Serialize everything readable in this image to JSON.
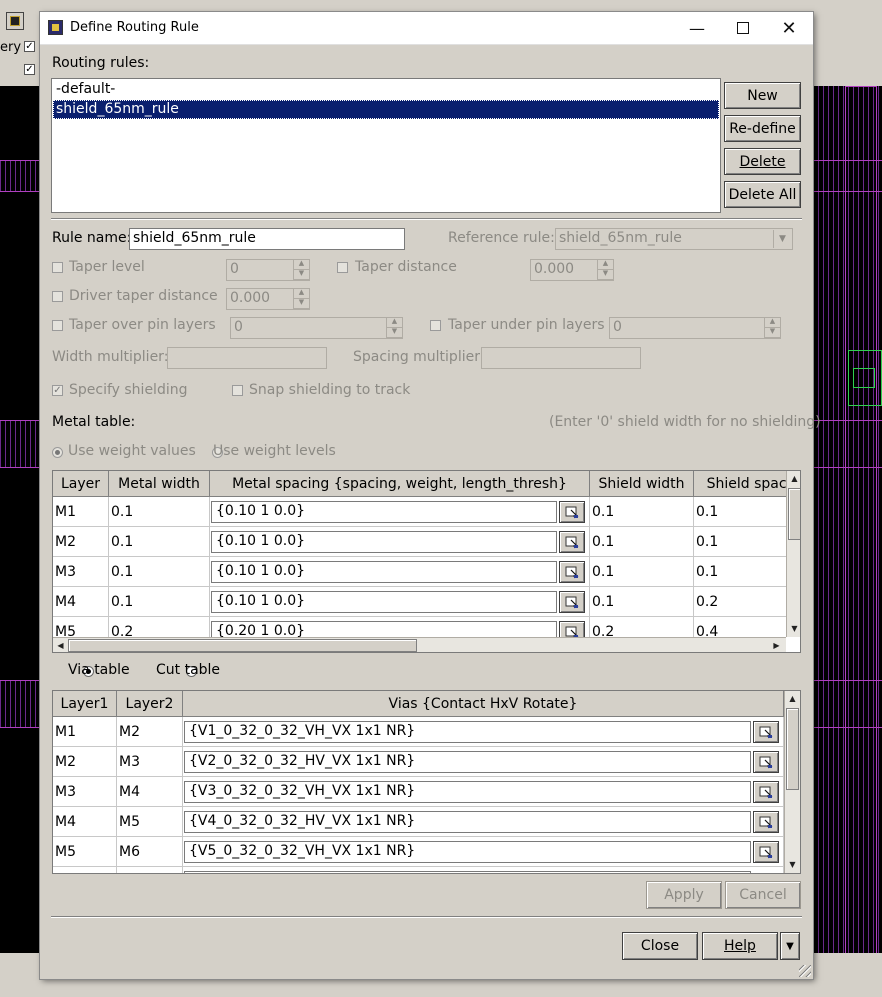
{
  "background": {
    "toolbar_fragment": "ery"
  },
  "dialog": {
    "title": "Define Routing Rule",
    "routing_rules_label": "Routing rules:",
    "routing_rules": [
      "-default-",
      "shield_65nm_rule"
    ],
    "selected_rule_index": 1,
    "side_buttons": {
      "new": "New",
      "redefine": "Re-define",
      "delete": "Delete",
      "delete_all": "Delete All"
    },
    "rule_name_label": "Rule name:",
    "rule_name_value": "shield_65nm_rule",
    "reference_rule_label": "Reference rule:",
    "reference_rule_value": "shield_65nm_rule",
    "taper_level_label": "Taper level",
    "taper_level_value": "0",
    "taper_distance_label": "Taper distance",
    "taper_distance_value": "0.000",
    "driver_taper_distance_label": "Driver taper distance",
    "driver_taper_distance_value": "0.000",
    "taper_over_pin_layers_label": "Taper over pin layers",
    "taper_over_pin_layers_value": "0",
    "taper_under_pin_layers_label": "Taper under pin layers",
    "taper_under_pin_layers_value": "0",
    "width_multiplier_label": "Width multiplier:",
    "spacing_multiplier_label": "Spacing multiplier:",
    "specify_shielding_label": "Specify shielding",
    "snap_shielding_label": "Snap shielding to track",
    "metal_table_label": "Metal table:",
    "shield_hint": "(Enter '0' shield width for no shielding)",
    "use_weight_values_label": "Use weight values",
    "use_weight_levels_label": "Use weight levels",
    "metal_table": {
      "headers": [
        "Layer",
        "Metal width",
        "Metal spacing {spacing, weight, length_thresh}",
        "Shield width",
        "Shield spaci"
      ],
      "rows": [
        {
          "layer": "M1",
          "width": "0.1",
          "spacing": "{0.10 1 0.0}",
          "shield_width": "0.1",
          "shield_spacing": "0.1"
        },
        {
          "layer": "M2",
          "width": "0.1",
          "spacing": "{0.10 1 0.0}",
          "shield_width": "0.1",
          "shield_spacing": "0.1"
        },
        {
          "layer": "M3",
          "width": "0.1",
          "spacing": "{0.10 1 0.0}",
          "shield_width": "0.1",
          "shield_spacing": "0.1"
        },
        {
          "layer": "M4",
          "width": "0.1",
          "spacing": "{0.10 1 0.0}",
          "shield_width": "0.1",
          "shield_spacing": "0.2"
        },
        {
          "layer": "M5",
          "width": "0.2",
          "spacing": "{0.20 1 0.0}",
          "shield_width": "0.2",
          "shield_spacing": "0.4"
        }
      ]
    },
    "via_table_label": "Via table",
    "cut_table_label": "Cut table",
    "via_table": {
      "headers": [
        "Layer1",
        "Layer2",
        "Vias  {Contact HxV Rotate}"
      ],
      "rows": [
        {
          "layer1": "M1",
          "layer2": "M2",
          "vias": "{V1_0_32_0_32_VH_VX 1x1 NR}"
        },
        {
          "layer1": "M2",
          "layer2": "M3",
          "vias": "{V2_0_32_0_32_HV_VX 1x1 NR}"
        },
        {
          "layer1": "M3",
          "layer2": "M4",
          "vias": "{V3_0_32_0_32_VH_VX 1x1 NR}"
        },
        {
          "layer1": "M4",
          "layer2": "M5",
          "vias": "{V4_0_32_0_32_HV_VX 1x1 NR}"
        },
        {
          "layer1": "M5",
          "layer2": "M6",
          "vias": "{V5_0_32_0_32_VH_VX 1x1 NR}"
        }
      ]
    },
    "apply_label": "Apply",
    "cancel_label": "Cancel",
    "close_label": "Close",
    "help_label": "Help"
  },
  "colors": {
    "selection": "#0a1f6e",
    "layout_lines": "#b040c0",
    "dialog_bg": "#d4d0c8"
  }
}
